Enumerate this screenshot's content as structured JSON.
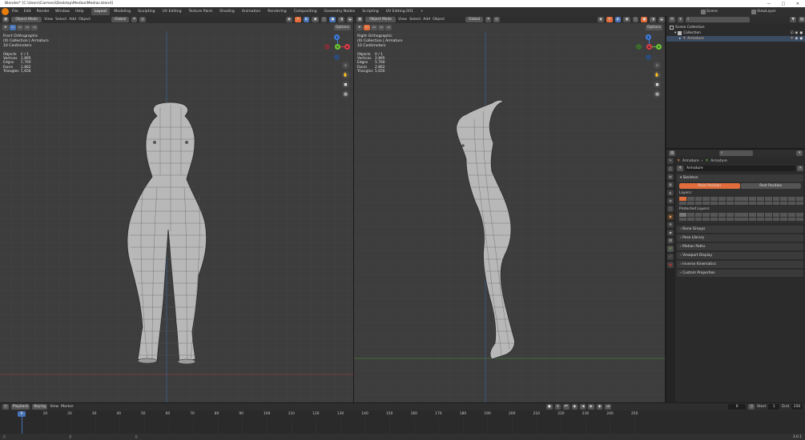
{
  "window": {
    "title": "Blender* [C:\\Users\\Carmesi\\Desktop\\Medias\\Medias.blend]",
    "controls": [
      "—",
      "□",
      "✕"
    ]
  },
  "menus": [
    "File",
    "Edit",
    "Render",
    "Window",
    "Help"
  ],
  "workspaces": [
    "Layout",
    "Modeling",
    "Sculpting",
    "UV Editing",
    "Texture Paint",
    "Shading",
    "Animation",
    "Rendering",
    "Compositing",
    "Geometry Nodes",
    "Scripting",
    "UV Editing.001"
  ],
  "active_workspace": "Layout",
  "scene": {
    "label": "Scene",
    "view_layer": "ViewLayer"
  },
  "viewport_left": {
    "mode": "Object Mode",
    "menus": [
      "View",
      "Select",
      "Add",
      "Object"
    ],
    "orientation": "Global",
    "options_label": "Options",
    "overlay_lines": [
      "Front Orthographic",
      "(0) Collection | Armature",
      "10 Centimeters"
    ],
    "stats": [
      {
        "key": "Objects",
        "value": "0 / 1"
      },
      {
        "key": "Vertices",
        "value": "2,895"
      },
      {
        "key": "Edges",
        "value": "5,760"
      },
      {
        "key": "Faces",
        "value": "2,862"
      },
      {
        "key": "Triangles",
        "value": "5,656"
      }
    ]
  },
  "viewport_right": {
    "mode": "Object Mode",
    "menus": [
      "View",
      "Select",
      "Add",
      "Object"
    ],
    "orientation": "Global",
    "options_label": "Options",
    "overlay_lines": [
      "Right Orthographic",
      "(0) Collection | Armature",
      "10 Centimeters"
    ],
    "stats": [
      {
        "key": "Objects",
        "value": "0 / 1"
      },
      {
        "key": "Vertices",
        "value": "2,895"
      },
      {
        "key": "Edges",
        "value": "5,760"
      },
      {
        "key": "Faces",
        "value": "2,862"
      },
      {
        "key": "Triangles",
        "value": "5,656"
      }
    ]
  },
  "gizmo": {
    "x": "X",
    "y": "Y",
    "z": "Z"
  },
  "outliner": {
    "scene_collection": "Scene Collection",
    "collection": "Collection",
    "object": "Armature"
  },
  "properties": {
    "breadcrumb": [
      "Armature",
      "Armature"
    ],
    "datablock": "Armature",
    "skeleton_label": "Skeleton",
    "pose_position": "Pose Position",
    "rest_position": "Rest Position",
    "layers_label": "Layers:",
    "protected_label": "Protected Layers:",
    "sections": [
      "Bone Groups",
      "Pose Library",
      "Motion Paths",
      "Viewport Display",
      "Inverse Kinematics",
      "Custom Properties"
    ]
  },
  "timeline": {
    "menus": [
      "Playback",
      "Keying",
      "View",
      "Marker"
    ],
    "current_frame": "0",
    "start_label": "Start",
    "start": "1",
    "end_label": "End",
    "end": "250",
    "ticks": [
      "0",
      "10",
      "20",
      "30",
      "40",
      "50",
      "60",
      "70",
      "80",
      "90",
      "100",
      "110",
      "120",
      "130",
      "140",
      "150",
      "160",
      "170",
      "180",
      "190",
      "200",
      "210",
      "220",
      "230",
      "240",
      "250"
    ]
  },
  "status": {
    "version": "3.0.1"
  },
  "colors": {
    "accent": "#4772b3",
    "active_button": "#e06d3b",
    "axis_x": "#db3b4b",
    "axis_y": "#6bc434",
    "axis_z": "#3f7dde"
  }
}
